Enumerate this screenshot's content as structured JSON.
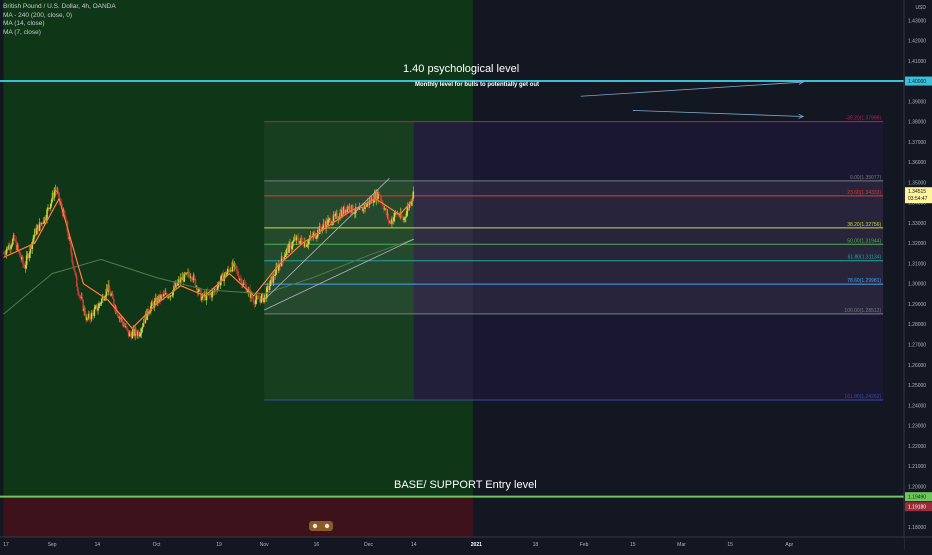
{
  "header": {
    "symbol": "British Pound / U.S. Dollar, 4h, OANDA",
    "indicators": [
      "MA - 240 (200, close, 0)",
      "MA (14, close)",
      "MA (7, close)"
    ]
  },
  "annotations": {
    "psych_level": "1.40 psychological level",
    "monthly_note": "Monthly level for bulls to potentially get out",
    "base_support": "BASE/ SUPPORT Entry level"
  },
  "price_axis": {
    "currency": "USD",
    "last_price": "1.34515",
    "countdown": "03:54:47",
    "psych_tag": "1.40000",
    "support_tag": "1.19490",
    "support_tag2": "1.19180"
  },
  "colors": {
    "background": "#131722",
    "green_zone": "#0f3717",
    "red_zone": "#3e121b",
    "fib_box": "#202c2f",
    "purple_zone": "#1a1730",
    "candle_up": "#c3d93e",
    "candle_down": "#c23d33",
    "ma_fast": "#e2393c",
    "ma_slow": "#ffeb3b",
    "ma_240": "#4f7a4c",
    "psych_line": "#3bbfd8",
    "support_line": "#6ec75a"
  },
  "chart_data": {
    "type": "line",
    "title": "British Pound / U.S. Dollar, 4h, OANDA",
    "xlabel": "",
    "ylabel": "",
    "ylim": [
      1.175,
      1.44
    ],
    "grid": false,
    "legend": "top-left",
    "x_ticks": [
      "17",
      "Sep",
      "14",
      "Oct",
      "19",
      "Nov",
      "16",
      "Dec",
      "14",
      "2021",
      "18",
      "Feb",
      "15",
      "Mar",
      "15",
      "Apr"
    ],
    "y_ticks": [
      "1.43000",
      "1.42000",
      "1.41000",
      "1.39000",
      "1.38000",
      "1.37000",
      "1.36000",
      "1.35000",
      "1.34000",
      "1.33000",
      "1.32000",
      "1.31000",
      "1.30000",
      "1.29000",
      "1.28000",
      "1.27000",
      "1.26000",
      "1.25000",
      "1.24000",
      "1.23000",
      "1.22000",
      "1.21000",
      "1.20000",
      "1.18000"
    ],
    "y_tick_values": [
      1.43,
      1.42,
      1.41,
      1.39,
      1.38,
      1.37,
      1.36,
      1.35,
      1.34,
      1.33,
      1.32,
      1.31,
      1.3,
      1.29,
      1.28,
      1.27,
      1.26,
      1.25,
      1.24,
      1.23,
      1.22,
      1.21,
      1.2,
      1.18
    ],
    "price_path": [
      {
        "x": "2020-08-18",
        "y": 1.315
      },
      {
        "x": "2020-08-21",
        "y": 1.322
      },
      {
        "x": "2020-08-24",
        "y": 1.308
      },
      {
        "x": "2020-08-27",
        "y": 1.325
      },
      {
        "x": "2020-08-30",
        "y": 1.333
      },
      {
        "x": "2020-09-02",
        "y": 1.347
      },
      {
        "x": "2020-09-05",
        "y": 1.33
      },
      {
        "x": "2020-09-08",
        "y": 1.3
      },
      {
        "x": "2020-09-11",
        "y": 1.282
      },
      {
        "x": "2020-09-14",
        "y": 1.288
      },
      {
        "x": "2020-09-17",
        "y": 1.298
      },
      {
        "x": "2020-09-20",
        "y": 1.285
      },
      {
        "x": "2020-09-23",
        "y": 1.275
      },
      {
        "x": "2020-09-26",
        "y": 1.276
      },
      {
        "x": "2020-09-29",
        "y": 1.288
      },
      {
        "x": "2020-10-02",
        "y": 1.293
      },
      {
        "x": "2020-10-05",
        "y": 1.295
      },
      {
        "x": "2020-10-08",
        "y": 1.302
      },
      {
        "x": "2020-10-11",
        "y": 1.305
      },
      {
        "x": "2020-10-14",
        "y": 1.293
      },
      {
        "x": "2020-10-17",
        "y": 1.295
      },
      {
        "x": "2020-10-20",
        "y": 1.303
      },
      {
        "x": "2020-10-23",
        "y": 1.309
      },
      {
        "x": "2020-10-26",
        "y": 1.3
      },
      {
        "x": "2020-10-29",
        "y": 1.292
      },
      {
        "x": "2020-11-01",
        "y": 1.293
      },
      {
        "x": "2020-11-04",
        "y": 1.305
      },
      {
        "x": "2020-11-07",
        "y": 1.315
      },
      {
        "x": "2020-11-10",
        "y": 1.322
      },
      {
        "x": "2020-11-13",
        "y": 1.32
      },
      {
        "x": "2020-11-16",
        "y": 1.325
      },
      {
        "x": "2020-11-19",
        "y": 1.33
      },
      {
        "x": "2020-11-22",
        "y": 1.333
      },
      {
        "x": "2020-11-25",
        "y": 1.338
      },
      {
        "x": "2020-11-28",
        "y": 1.335
      },
      {
        "x": "2020-12-01",
        "y": 1.34
      },
      {
        "x": "2020-12-04",
        "y": 1.345
      },
      {
        "x": "2020-12-07",
        "y": 1.33
      },
      {
        "x": "2020-12-09",
        "y": 1.335
      },
      {
        "x": "2020-12-11",
        "y": 1.3315
      },
      {
        "x": "2020-12-14",
        "y": 1.34515
      }
    ],
    "ma_fast": [
      {
        "x": "2020-08-18",
        "y": 1.313
      },
      {
        "x": "2020-08-27",
        "y": 1.32
      },
      {
        "x": "2020-09-03",
        "y": 1.342
      },
      {
        "x": "2020-09-10",
        "y": 1.3
      },
      {
        "x": "2020-09-17",
        "y": 1.292
      },
      {
        "x": "2020-09-24",
        "y": 1.278
      },
      {
        "x": "2020-10-01",
        "y": 1.29
      },
      {
        "x": "2020-10-08",
        "y": 1.299
      },
      {
        "x": "2020-10-15",
        "y": 1.294
      },
      {
        "x": "2020-10-22",
        "y": 1.305
      },
      {
        "x": "2020-10-29",
        "y": 1.294
      },
      {
        "x": "2020-11-05",
        "y": 1.309
      },
      {
        "x": "2020-11-12",
        "y": 1.32
      },
      {
        "x": "2020-11-19",
        "y": 1.328
      },
      {
        "x": "2020-11-26",
        "y": 1.336
      },
      {
        "x": "2020-12-03",
        "y": 1.342
      },
      {
        "x": "2020-12-10",
        "y": 1.334
      },
      {
        "x": "2020-12-14",
        "y": 1.342
      }
    ],
    "ma_240": [
      {
        "x": "2020-08-18",
        "y": 1.285
      },
      {
        "x": "2020-09-01",
        "y": 1.305
      },
      {
        "x": "2020-09-15",
        "y": 1.312
      },
      {
        "x": "2020-10-01",
        "y": 1.303
      },
      {
        "x": "2020-10-15",
        "y": 1.297
      },
      {
        "x": "2020-11-01",
        "y": 1.295
      },
      {
        "x": "2020-11-15",
        "y": 1.303
      },
      {
        "x": "2020-12-01",
        "y": 1.314
      },
      {
        "x": "2020-12-14",
        "y": 1.322
      }
    ],
    "trend_line": [
      {
        "x": "2020-11-01",
        "y": 1.287
      },
      {
        "x": "2020-12-14",
        "y": 1.322
      }
    ],
    "channel_line": [
      {
        "x": "2020-11-01",
        "y": 1.292
      },
      {
        "x": "2020-12-07",
        "y": 1.352
      }
    ],
    "fibonacci": {
      "start": "2020-11-01",
      "end": "2021-04-28",
      "levels": [
        {
          "label": "-38.20(1.37999)",
          "price": 1.37999,
          "color": "#c2185b"
        },
        {
          "label": "0.00(1.35077)",
          "price": 1.35077,
          "color": "#787b86"
        },
        {
          "label": "23.60(1.34333)",
          "price": 1.34333,
          "color": "#e53935"
        },
        {
          "label": "38.20(1.32756)",
          "price": 1.32756,
          "color": "#cddc39"
        },
        {
          "label": "50.00(1.31944)",
          "price": 1.31944,
          "color": "#4caf50"
        },
        {
          "label": "61.80(1.31134)",
          "price": 1.31134,
          "color": "#26a69a"
        },
        {
          "label": "78.60(1.29981)",
          "price": 1.29981,
          "color": "#42a5f5"
        },
        {
          "label": "100.00(1.28512)",
          "price": 1.28512,
          "color": "#787b86"
        },
        {
          "label": "161.80(1.24262)",
          "price": 1.24262,
          "color": "#3949ab"
        }
      ]
    },
    "levels": {
      "psychological": 1.4,
      "base_support": 1.1949
    },
    "shaded_zones": [
      {
        "name": "green",
        "x_start": "2020-08-18",
        "x_end": "2020-12-31",
        "y_from": 1.44,
        "y_to": 1.1949
      },
      {
        "name": "red",
        "x_start": "2020-08-18",
        "x_end": "2020-12-31",
        "y_from": 1.1949,
        "y_to": 1.175
      },
      {
        "name": "purple",
        "x_start": "2020-12-14",
        "x_end": "2021-04-28",
        "y_from": 1.38,
        "y_to": 1.2426
      }
    ],
    "arrows": [
      {
        "from": {
          "x": "2021-01-31",
          "y": 1.3925
        },
        "to": {
          "x": "2021-04-05",
          "y": 1.3995
        }
      },
      {
        "from": {
          "x": "2021-02-15",
          "y": 1.3855
        },
        "to": {
          "x": "2021-04-05",
          "y": 1.3825
        }
      }
    ]
  }
}
